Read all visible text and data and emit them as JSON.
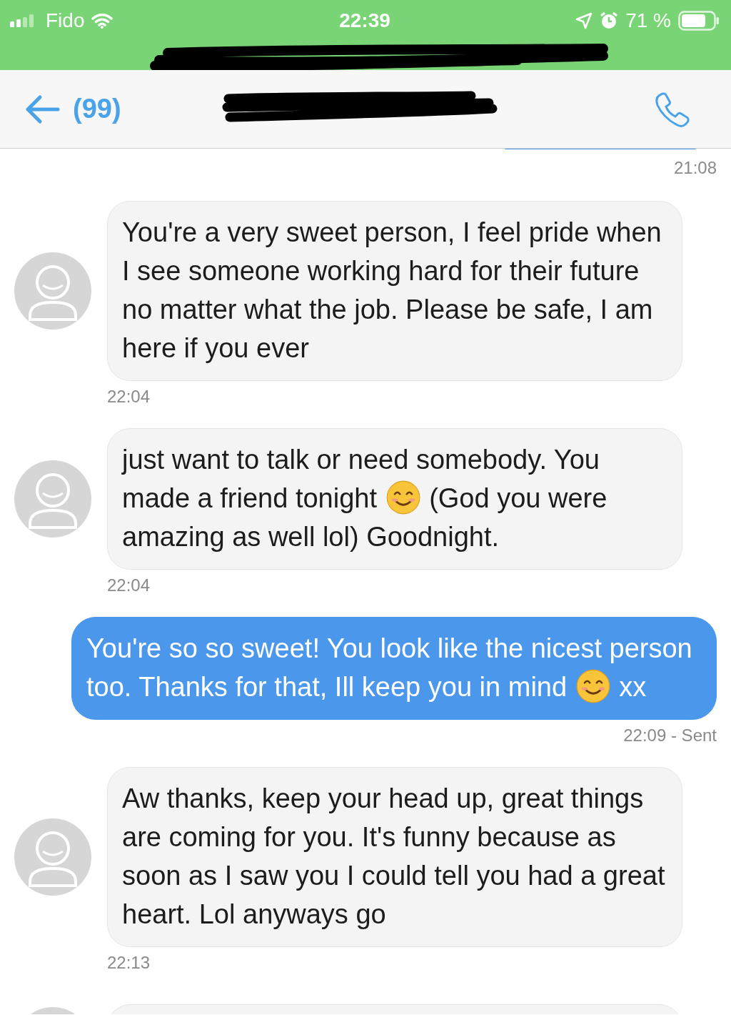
{
  "status_bar": {
    "carrier": "Fido",
    "time": "22:39",
    "battery": "71 %"
  },
  "header": {
    "back_count": "(99)"
  },
  "messages": [
    {
      "kind": "sent",
      "cut_off": true,
      "time": "21:08"
    },
    {
      "kind": "received",
      "segments": [
        {
          "kind": "text",
          "text": "You're a very sweet person, I feel pride when I see someone working hard for their future no matter what the job. Please be safe, I am here if you ever"
        }
      ],
      "time": "22:04"
    },
    {
      "kind": "received",
      "segments": [
        {
          "kind": "text",
          "text": "just want to talk or need somebody. You made a friend tonight"
        },
        {
          "kind": "emoji"
        },
        {
          "kind": "text",
          "text": "(God you were amazing as well lol) Goodnight."
        }
      ],
      "time": "22:04"
    },
    {
      "kind": "sent",
      "segments": [
        {
          "kind": "text",
          "text": "You're so so sweet! You look like the nicest person too. Thanks for that, Ill keep you in mind"
        },
        {
          "kind": "emoji"
        },
        {
          "kind": "text",
          "text": "xx"
        }
      ],
      "time": "22:09 - Sent"
    },
    {
      "kind": "received",
      "segments": [
        {
          "kind": "text",
          "text": "Aw thanks, keep your head up, great things are coming for you. It's funny because as soon as I saw you I could tell you had a great heart. Lol anyways go"
        }
      ],
      "time": "22:13"
    },
    {
      "kind": "received",
      "cut_off": true
    }
  ]
}
